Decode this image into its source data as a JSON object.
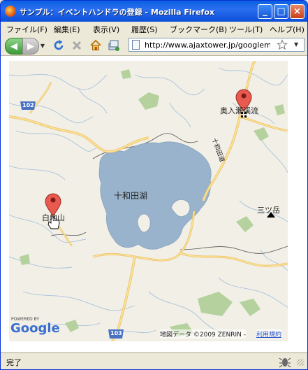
{
  "window": {
    "title": "サンプル：イベントハンドラの登録 - Mozilla Firefox"
  },
  "menu": {
    "items": [
      "ファイル(F)",
      "編集(E)",
      "表示(V)",
      "履歴(S)",
      "ブックマーク(B)",
      "ツール(T)",
      "ヘルプ(H)"
    ]
  },
  "nav": {
    "url": "http://www.ajaxtower.jp/googlemap"
  },
  "map": {
    "lake_label": "十和田湖",
    "markers": [
      {
        "label": "奥入瀬渓流"
      },
      {
        "label": "白地山"
      }
    ],
    "mountain_label": "三ツ岳",
    "road_label": "十和田道",
    "route_shields": [
      "102",
      "103"
    ],
    "powered_by": "POWERED BY",
    "logo": "Google",
    "copyright": "地図データ ©2009 ZENRIN -",
    "terms_link": "利用規約"
  },
  "status": {
    "text": "完了"
  },
  "colors": {
    "water": "#99b3cc",
    "land": "#f2efe6",
    "park": "#b5d29e",
    "road": "#fdd36a",
    "marker": "#e85a4f"
  }
}
